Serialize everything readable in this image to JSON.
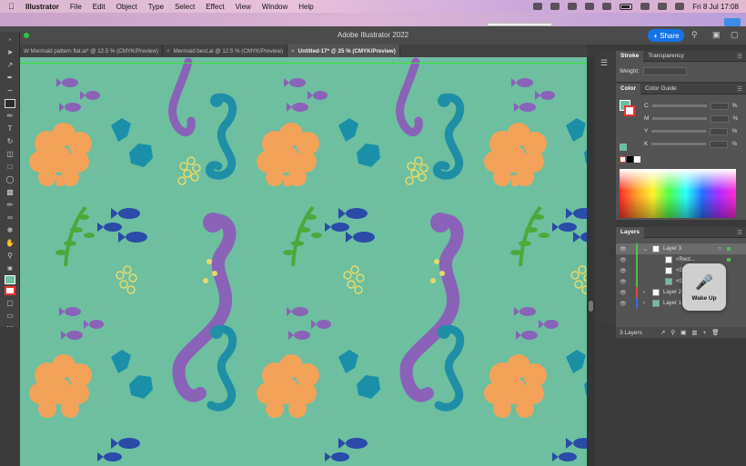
{
  "menubar": {
    "app": "Illustrator",
    "items": [
      "File",
      "Edit",
      "Object",
      "Type",
      "Select",
      "Effect",
      "View",
      "Window",
      "Help"
    ],
    "clock": "Fri 8 Jul  17:08"
  },
  "titlebar": {
    "title": "Adobe Illustrator 2022",
    "share": "Share"
  },
  "tabs": [
    {
      "label": "W Mermaid pattern flat.ai* @ 12.5 % (CMYK/Preview)",
      "active": false
    },
    {
      "label": "Mermaid best.ai @ 12.5 % (CMYK/Preview)",
      "active": false
    },
    {
      "label": "Untitled-17* @ 25 % (CMYK/Preview)",
      "active": true
    }
  ],
  "stroke_panel": {
    "tabs": [
      "Stroke",
      "Transparency"
    ],
    "weight_label": "Weight:"
  },
  "color_panel": {
    "tabs": [
      "Color",
      "Color Guide"
    ],
    "channels": [
      "C",
      "M",
      "Y",
      "K"
    ],
    "unit": "%"
  },
  "layers_panel": {
    "title": "Layers",
    "rows": [
      {
        "name": "Layer 3",
        "selected": true,
        "color": "#4fbf4f"
      },
      {
        "name": "<Rect...",
        "selected": false,
        "color": "#4fbf4f"
      },
      {
        "name": "<G...",
        "selected": false,
        "color": "#4fbf4f"
      },
      {
        "name": "<G...",
        "selected": false,
        "color": "#4fbf4f"
      },
      {
        "name": "Layer 2",
        "selected": false,
        "color": "#d84a4a"
      },
      {
        "name": "Layer 1",
        "selected": false,
        "color": "#3a6bd8"
      }
    ],
    "count": "3 Layers"
  },
  "voice": {
    "label": "Wake Up"
  },
  "colors": {
    "canvas_bg": "#6dbfa0",
    "seahorse_purple": "#8a62b8",
    "seahorse_teal": "#1f8fa6",
    "coral_orange": "#f3a25a",
    "fish_blue": "#2a4ba8",
    "weed_green": "#4ea83a",
    "bubble_yellow": "#e8d96a",
    "fan_teal": "#1b8fa8"
  }
}
